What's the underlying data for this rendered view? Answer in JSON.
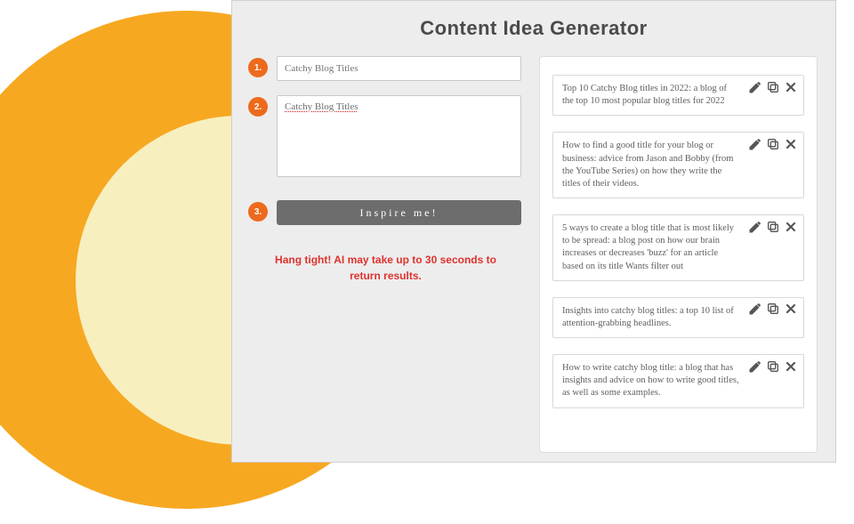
{
  "title": "Content Idea Generator",
  "steps": {
    "s1": {
      "badge": "1.",
      "placeholder": "Catchy Blog Titles"
    },
    "s2": {
      "badge": "2.",
      "value": "Catchy Blog Titles"
    },
    "s3": {
      "badge": "3.",
      "button": "Inspire me!"
    }
  },
  "wait_message": "Hang tight! AI may take up to 30 seconds to return results.",
  "results": [
    "Top 10 Catchy Blog titles in 2022: a blog of the top 10 most popular blog titles for 2022",
    "How to find a good title for your blog or business: advice from Jason and Bobby (from the YouTube Series) on how they write the titles of their videos.",
    "5 ways to create a blog title that is most likely to be spread: a blog post on how our brain increases or decreases 'buzz' for an article based on its title Wants filter out",
    "Insights into catchy blog titles: a top 10 list of attention-grabbing headlines.",
    "How to write catchy blog title: a blog that has insights and advice on how to write good titles, as well as some examples."
  ]
}
